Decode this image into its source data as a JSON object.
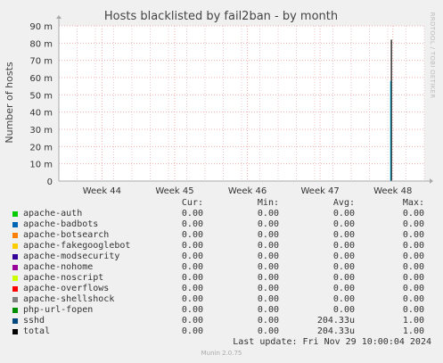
{
  "chart_data": {
    "type": "line",
    "title": "Hosts blacklisted by fail2ban - by month",
    "ylabel": "Number of hosts",
    "watermark": "RRDTOOL / TOBI OETIKER",
    "ylim": [
      0,
      90
    ],
    "y_ticks": [
      {
        "value": 0,
        "label": "0"
      },
      {
        "value": 10,
        "label": "10 m"
      },
      {
        "value": 20,
        "label": "20 m"
      },
      {
        "value": 30,
        "label": "30 m"
      },
      {
        "value": 40,
        "label": "40 m"
      },
      {
        "value": 50,
        "label": "50 m"
      },
      {
        "value": 60,
        "label": "60 m"
      },
      {
        "value": 70,
        "label": "70 m"
      },
      {
        "value": 80,
        "label": "80 m"
      },
      {
        "value": 90,
        "label": "90 m"
      }
    ],
    "x_range": [
      0,
      100
    ],
    "x_ticks": [
      {
        "value": 11.8,
        "label": "Week 44"
      },
      {
        "value": 31.7,
        "label": "Week 45"
      },
      {
        "value": 51.6,
        "label": "Week 46"
      },
      {
        "value": 71.5,
        "label": "Week 47"
      },
      {
        "value": 91.4,
        "label": "Week 48"
      }
    ],
    "x_minor": [
      0,
      5,
      10,
      15,
      20,
      25,
      30,
      35,
      40,
      45,
      50,
      55,
      60,
      65,
      70,
      75,
      80,
      85,
      90,
      95,
      100
    ],
    "grid": true,
    "spikes": [
      {
        "series": "sshd",
        "x": 90.8,
        "value": 58,
        "color": "#00ccff"
      },
      {
        "series": "total",
        "x": 91.0,
        "value": 82,
        "color": "#000000"
      }
    ],
    "colors": {
      "background": "#f0f0f0",
      "plot": "#ffffff",
      "grid_minor": "#e8c8c8",
      "grid_major": "#f0b0b0",
      "axis": "#aaaaaa"
    }
  },
  "legend": {
    "headers": {
      "cur": "Cur:",
      "min": "Min:",
      "avg": "Avg:",
      "max": "Max:"
    },
    "rows": [
      {
        "name": "apache-auth",
        "color": "#00cc00",
        "cur": "0.00",
        "min": "0.00",
        "avg": "0.00",
        "max": "0.00"
      },
      {
        "name": "apache-badbots",
        "color": "#0066b3",
        "cur": "0.00",
        "min": "0.00",
        "avg": "0.00",
        "max": "0.00"
      },
      {
        "name": "apache-botsearch",
        "color": "#ff8000",
        "cur": "0.00",
        "min": "0.00",
        "avg": "0.00",
        "max": "0.00"
      },
      {
        "name": "apache-fakegooglebot",
        "color": "#ffcc00",
        "cur": "0.00",
        "min": "0.00",
        "avg": "0.00",
        "max": "0.00"
      },
      {
        "name": "apache-modsecurity",
        "color": "#330099",
        "cur": "0.00",
        "min": "0.00",
        "avg": "0.00",
        "max": "0.00"
      },
      {
        "name": "apache-nohome",
        "color": "#990099",
        "cur": "0.00",
        "min": "0.00",
        "avg": "0.00",
        "max": "0.00"
      },
      {
        "name": "apache-noscript",
        "color": "#ccff00",
        "cur": "0.00",
        "min": "0.00",
        "avg": "0.00",
        "max": "0.00"
      },
      {
        "name": "apache-overflows",
        "color": "#ff0000",
        "cur": "0.00",
        "min": "0.00",
        "avg": "0.00",
        "max": "0.00"
      },
      {
        "name": "apache-shellshock",
        "color": "#808080",
        "cur": "0.00",
        "min": "0.00",
        "avg": "0.00",
        "max": "0.00"
      },
      {
        "name": "php-url-fopen",
        "color": "#008f00",
        "cur": "0.00",
        "min": "0.00",
        "avg": "0.00",
        "max": "0.00"
      },
      {
        "name": "sshd",
        "color": "#00487d",
        "cur": "0.00",
        "min": "0.00",
        "avg": "204.33u",
        "max": "1.00"
      },
      {
        "name": "total",
        "color": "#000000",
        "cur": "0.00",
        "min": "0.00",
        "avg": "204.33u",
        "max": "1.00"
      }
    ]
  },
  "last_update": "Last update: Fri Nov 29 10:00:04 2024",
  "footer": "Munin 2.0.75"
}
